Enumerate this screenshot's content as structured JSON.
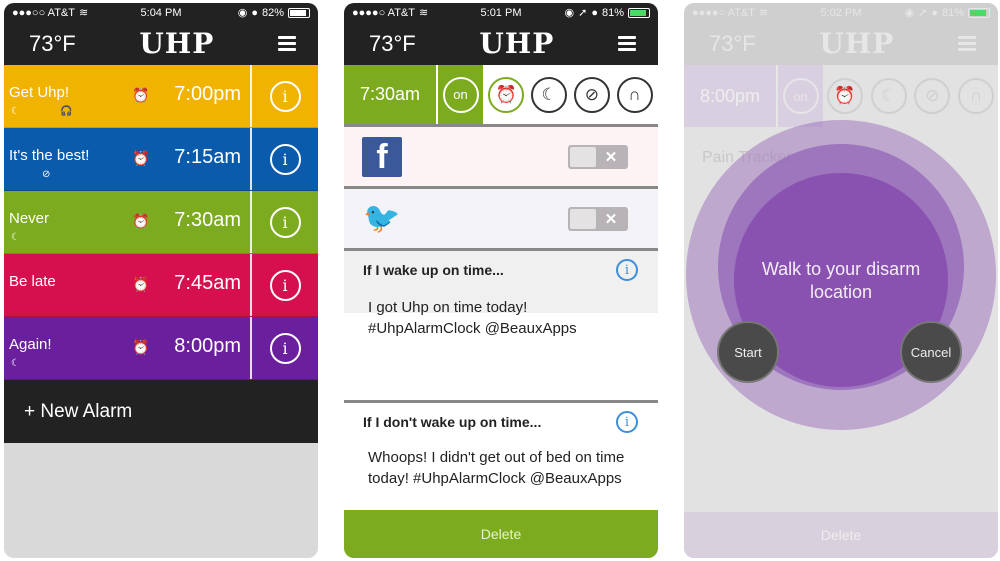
{
  "colors": {
    "yellow": "#f0b400",
    "blue": "#0a5bab",
    "green": "#7cab1f",
    "red": "#d6104e",
    "purple": "#6a1f9c",
    "dark": "#222222"
  },
  "panels": [
    {
      "status": {
        "carrier": "●●●○○ AT&T",
        "wifi": "wifi-icon",
        "time": "5:04 PM",
        "battery": "82%"
      },
      "header": {
        "temperature": "73°F",
        "logo": "UHP"
      },
      "alarms": [
        {
          "name": "Get Uhp!",
          "time": "7:00pm",
          "sub_icons": [
            "☾",
            "🎧"
          ],
          "color": "#f0b400"
        },
        {
          "name": "It's the best!",
          "time": "7:15am",
          "sub_icons": [
            "⊘"
          ],
          "color": "#0a5bab"
        },
        {
          "name": "Never",
          "time": "7:30am",
          "sub_icons": [
            "☾"
          ],
          "color": "#7cab1f"
        },
        {
          "name": "Be late",
          "time": "7:45am",
          "sub_icons": [],
          "color": "#d6104e"
        },
        {
          "name": "Again!",
          "time": "8:00pm",
          "sub_icons": [
            "☾"
          ],
          "color": "#6a1f9c"
        }
      ],
      "new_alarm_label": "+ New Alarm"
    },
    {
      "status": {
        "carrier": "●●●●○ AT&T",
        "time": "5:01 PM",
        "battery": "81%"
      },
      "header": {
        "temperature": "73°F",
        "logo": "UHP"
      },
      "alarm_time": "7:30am",
      "on_label": "on",
      "icons": [
        "alarm-clock-icon",
        "moon-icon",
        "compass-icon",
        "headphones-icon"
      ],
      "social": [
        {
          "name": "facebook",
          "glyph": "f"
        },
        {
          "name": "twitter",
          "glyph": "🐦"
        }
      ],
      "toggle_x": "✕",
      "messages": [
        {
          "title": "If I wake up on time...",
          "body": "I got Uhp on time today! #UhpAlarmClock @BeauxApps"
        },
        {
          "title": "If I don't wake up on time...",
          "body": "Whoops! I didn't get out of bed on time today!  #UhpAlarmClock @BeauxApps"
        }
      ],
      "delete_label": "Delete"
    },
    {
      "status": {
        "carrier": "●●●●○ AT&T",
        "time": "5:02 PM",
        "battery": "81%"
      },
      "header": {
        "temperature": "73°F",
        "logo": "UHP"
      },
      "alarm_time": "8:00pm",
      "on_label": "on",
      "row_label": "Pain Tracker",
      "prompt": "Walk to your disarm location",
      "start_label": "Start",
      "cancel_label": "Cancel",
      "delete_label": "Delete"
    }
  ]
}
